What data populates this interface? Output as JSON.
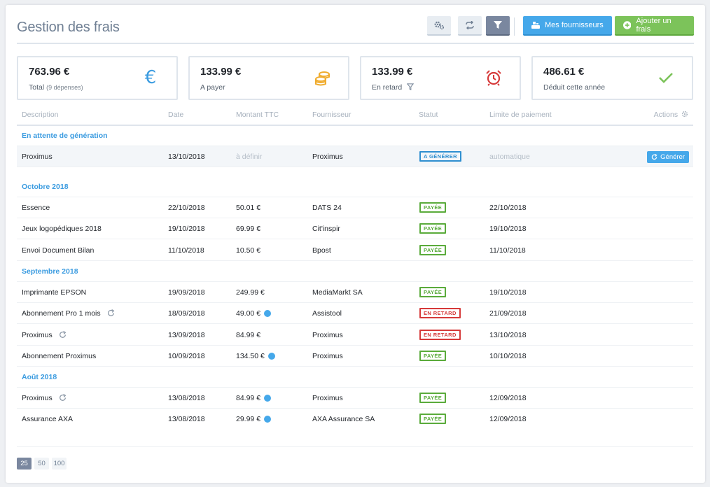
{
  "header": {
    "title": "Gestion des frais",
    "buttons": {
      "settings": "gears-icon",
      "transfer": "swap-arrows-icon",
      "filter": "filter-icon",
      "suppliers": "Mes fournisseurs",
      "add": "Ajouter un frais"
    }
  },
  "stats": [
    {
      "value": "763.96 €",
      "label": "Total",
      "note": "(9 dépenses)",
      "icon": "euro-icon",
      "color": "#3a9be0"
    },
    {
      "value": "133.99 €",
      "label": "A payer",
      "note": "",
      "icon": "coins-icon",
      "color": "#f0ac2e"
    },
    {
      "value": "133.99 €",
      "label": "En retard",
      "note": "",
      "icon": "alarm-clock-icon",
      "color": "#d63a3a"
    },
    {
      "value": "486.61 €",
      "label": "Déduit cette année",
      "note": "",
      "icon": "check-icon",
      "color": "#7cc35a"
    }
  ],
  "table": {
    "columns": [
      "Description",
      "Date",
      "Montant TTC",
      "Fournisseur",
      "Statut",
      "Limite de paiement",
      "Actions"
    ],
    "groups": [
      {
        "title": "En attente de génération",
        "rows": [
          {
            "desc": "Proximus",
            "date": "13/10/2018",
            "amount": "à définir",
            "supplier": "Proximus",
            "status": "A GÉNÉRER",
            "limit": "automatique",
            "action": "Générer"
          }
        ]
      },
      {
        "title": "Octobre 2018",
        "rows": [
          {
            "desc": "Essence",
            "date": "22/10/2018",
            "amount": "50.01 €",
            "supplier": "DATS 24",
            "status": "PAYÉE",
            "limit": "22/10/2018"
          },
          {
            "desc": "Jeux logopédiques 2018",
            "date": "19/10/2018",
            "amount": "69.99 €",
            "supplier": "Cit'inspir",
            "status": "PAYÉE",
            "limit": "19/10/2018"
          },
          {
            "desc": "Envoi Document Bilan",
            "date": "11/10/2018",
            "amount": "10.50 €",
            "supplier": "Bpost",
            "status": "PAYÉE",
            "limit": "11/10/2018"
          }
        ]
      },
      {
        "title": "Septembre 2018",
        "rows": [
          {
            "desc": "Imprimante EPSON",
            "date": "19/09/2018",
            "amount": "249.99 €",
            "supplier": "MediaMarkt SA",
            "status": "PAYÉE",
            "limit": "19/10/2018"
          },
          {
            "desc": "Abonnement Pro 1 mois",
            "date": "18/09/2018",
            "amount": "49.00 €",
            "supplier": "Assistool",
            "status": "EN RETARD",
            "limit": "21/09/2018"
          },
          {
            "desc": "Proximus",
            "date": "13/09/2018",
            "amount": "84.99 €",
            "supplier": "Proximus",
            "status": "EN RETARD",
            "limit": "13/10/2018"
          },
          {
            "desc": "Abonnement Proximus",
            "date": "10/09/2018",
            "amount": "134.50 €",
            "supplier": "Proximus",
            "status": "PAYÉE",
            "limit": "10/10/2018"
          }
        ]
      },
      {
        "title": "Août 2018",
        "rows": [
          {
            "desc": "Proximus",
            "date": "13/08/2018",
            "amount": "84.99 €",
            "supplier": "Proximus",
            "status": "PAYÉE",
            "limit": "12/09/2018"
          },
          {
            "desc": "Assurance AXA",
            "date": "13/08/2018",
            "amount": "29.99 €",
            "supplier": "AXA Assurance SA",
            "status": "PAYÉE",
            "limit": "12/09/2018"
          }
        ]
      }
    ]
  },
  "pagination": {
    "options": [
      "25",
      "50",
      "100"
    ],
    "selected": "25"
  }
}
